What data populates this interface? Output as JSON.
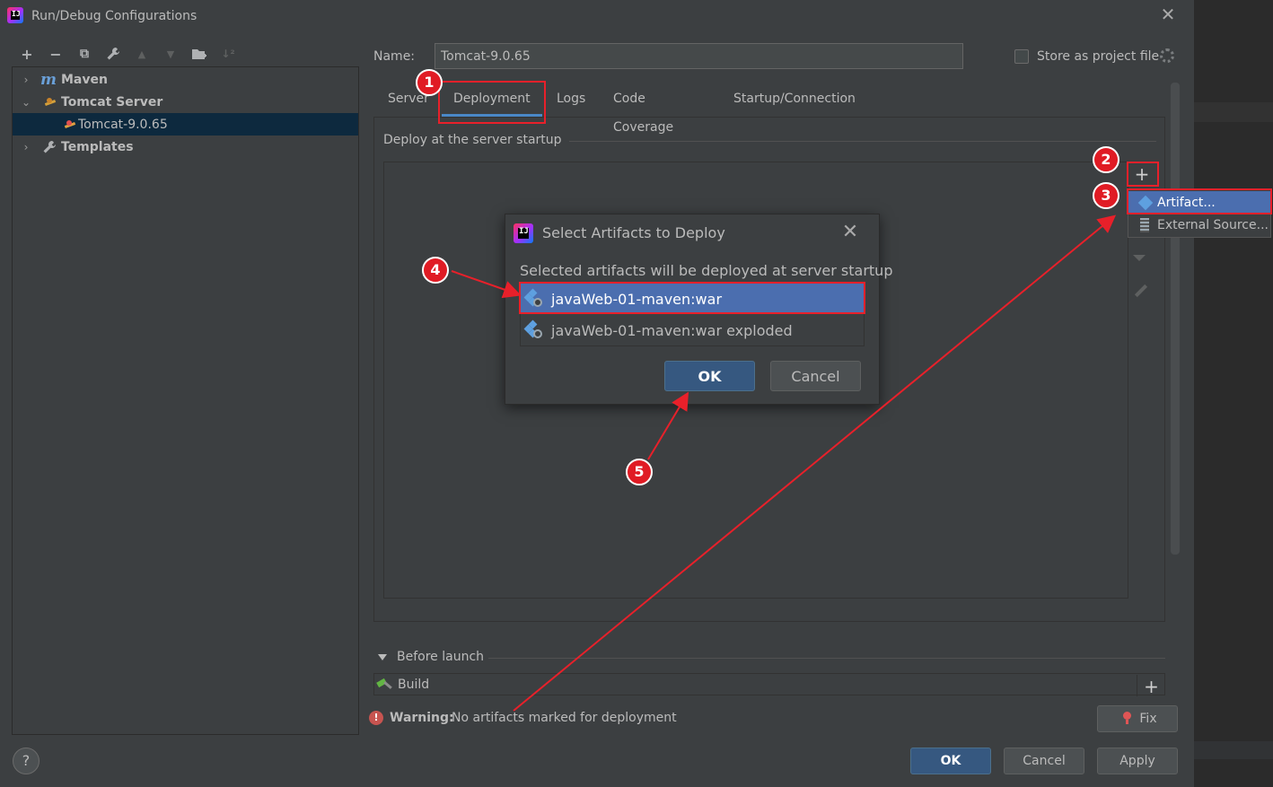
{
  "window": {
    "title": "Run/Debug Configurations",
    "close": "✕"
  },
  "toolbar": {
    "add": "+",
    "remove": "−",
    "copy": "⧉",
    "edit": "🔧",
    "up": "▲",
    "down": "▼",
    "folder": "📁",
    "sort": "↓²"
  },
  "tree": {
    "items": [
      {
        "label": "Maven",
        "icon": "maven-icon"
      },
      {
        "label": "Tomcat Server",
        "icon": "tomcat-icon"
      },
      {
        "label": "Tomcat-9.0.65",
        "icon": "tomcat-config-icon"
      },
      {
        "label": "Templates",
        "icon": "wrench-icon"
      }
    ]
  },
  "form": {
    "name_label": "Name:",
    "name_value": "Tomcat-9.0.65",
    "store_label": "Store as project file"
  },
  "tabs": [
    {
      "label": "Server"
    },
    {
      "label": "Deployment"
    },
    {
      "label": "Logs"
    },
    {
      "label": "Code Coverage"
    },
    {
      "label": "Startup/Connection"
    }
  ],
  "deploy": {
    "group_title": "Deploy at the server startup",
    "plus": "+"
  },
  "popup": {
    "items": [
      {
        "label": "Artifact..."
      },
      {
        "label": "External Source..."
      }
    ]
  },
  "dialog": {
    "title": "Select Artifacts to Deploy",
    "close": "✕",
    "description": "Selected artifacts will be deployed at server startup",
    "items": [
      {
        "label": "javaWeb-01-maven:war"
      },
      {
        "label": "javaWeb-01-maven:war exploded"
      }
    ],
    "ok": "OK",
    "cancel": "Cancel"
  },
  "before_launch": {
    "title": "Before launch",
    "build_label": "Build",
    "plus": "+"
  },
  "warning": {
    "icon": "!",
    "label": "Warning:",
    "text": "No artifacts marked for deployment",
    "fix": "Fix"
  },
  "footer": {
    "help": "?",
    "ok": "OK",
    "cancel": "Cancel",
    "apply": "Apply"
  },
  "annotations": {
    "badges": [
      "1",
      "2",
      "3",
      "4",
      "5"
    ],
    "color": "#e8202a"
  },
  "colors": {
    "selection": "#4b6eaf",
    "tab_underline": "#4a88c7",
    "primary_button": "#365880"
  }
}
